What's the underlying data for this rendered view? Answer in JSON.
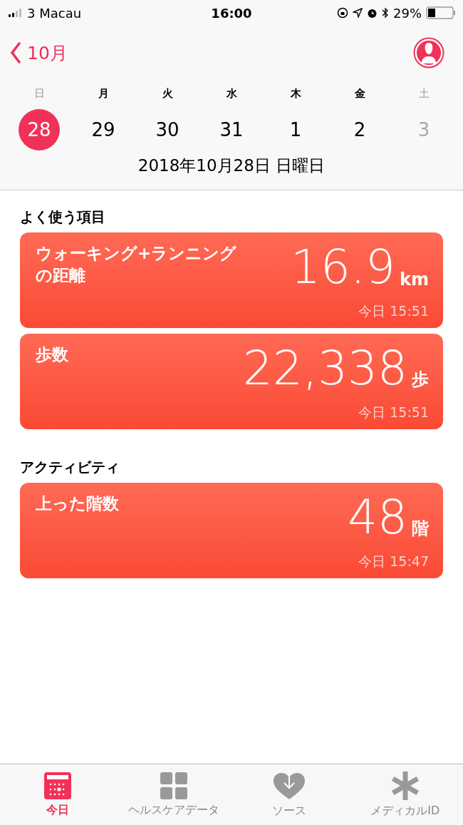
{
  "status_bar": {
    "carrier": "3 Macau",
    "time": "16:00",
    "battery": "29%"
  },
  "nav": {
    "back": "10月"
  },
  "weekdays": [
    {
      "label": "日",
      "muted": true
    },
    {
      "label": "月",
      "muted": false
    },
    {
      "label": "火",
      "muted": false
    },
    {
      "label": "水",
      "muted": false
    },
    {
      "label": "木",
      "muted": false
    },
    {
      "label": "金",
      "muted": false
    },
    {
      "label": "土",
      "muted": true
    }
  ],
  "dates": [
    {
      "label": "28",
      "selected": true,
      "muted": false
    },
    {
      "label": "29",
      "selected": false,
      "muted": false
    },
    {
      "label": "30",
      "selected": false,
      "muted": false
    },
    {
      "label": "31",
      "selected": false,
      "muted": false
    },
    {
      "label": "1",
      "selected": false,
      "muted": false
    },
    {
      "label": "2",
      "selected": false,
      "muted": false
    },
    {
      "label": "3",
      "selected": false,
      "muted": true
    }
  ],
  "date_label": "2018年10月28日 日曜日",
  "sections": [
    {
      "title": "よく使う項目",
      "cards": [
        {
          "name": "ウォーキング+ランニングの距離",
          "value": "16.9",
          "unit": "km",
          "time": "今日 15:51"
        },
        {
          "name": "歩数",
          "value": "22,338",
          "unit": "歩",
          "time": "今日 15:51"
        }
      ]
    },
    {
      "title": "アクティビティ",
      "cards": [
        {
          "name": "上った階数",
          "value": "48",
          "unit": "階",
          "time": "今日 15:47"
        }
      ]
    }
  ],
  "tabs": [
    {
      "label": "今日",
      "kind": "calendar",
      "selected": true
    },
    {
      "label": "ヘルスケアデータ",
      "kind": "grid",
      "selected": false
    },
    {
      "label": "ソース",
      "kind": "heart",
      "selected": false
    },
    {
      "label": "メディカルID",
      "kind": "asterisk",
      "selected": false
    }
  ]
}
